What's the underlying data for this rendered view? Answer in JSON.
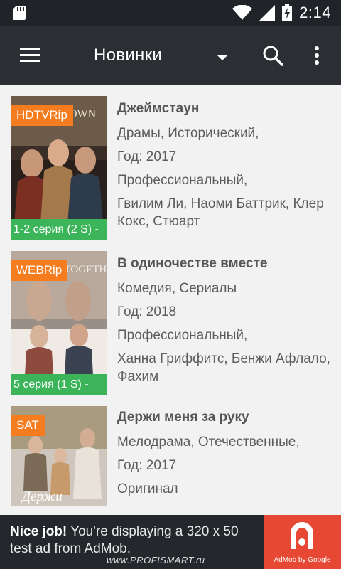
{
  "status_bar": {
    "time": "2:14",
    "icons": [
      "sd-card-icon",
      "wifi-icon",
      "signal-icon",
      "battery-charging-icon"
    ]
  },
  "app_bar": {
    "title": "Новинки",
    "icons": [
      "menu-icon",
      "dropdown-arrow-icon",
      "search-icon",
      "more-vert-icon"
    ]
  },
  "items": [
    {
      "badge": "HDTVRip",
      "title": "Джеймстаун",
      "genres": "Драмы, Исторический,",
      "year": "Год: 2017",
      "translation": "Профессиональный,",
      "cast": "Гвилим Ли, Наоми Баттрик, Клер Кокс, Стюарт",
      "episodes": "1-2 серия (2 S) -",
      "poster_text": "OWN"
    },
    {
      "badge": "WEBRip",
      "title": "В одиночестве вместе",
      "genres": "Комедия, Сериалы",
      "year": "Год: 2018",
      "translation": "Профессиональный,",
      "cast": "Ханна Гриффитс, Бенжи Афлало, Фахим",
      "episodes": "5 серия (1 S) -",
      "poster_text": "NE TOGETHER"
    },
    {
      "badge": "SAT",
      "title": "Держи меня за руку",
      "genres": "Мелодрама, Отечественные,",
      "year": "Год: 2017",
      "translation": "Оригинал",
      "poster_text": "Держи"
    }
  ],
  "ad": {
    "headline": "Nice job!",
    "text": "You're displaying a 320 x 50 test ad from AdMob.",
    "brand": "AdMob by Google"
  },
  "watermark": "www.PROFISMART.ru",
  "colors": {
    "status_bar": "#202428",
    "app_bar": "#2b2f33",
    "badge": "#f57c1f",
    "episode_bar": "#3bb45a",
    "ad_background": "#24282c",
    "admob_red": "#e74833"
  }
}
